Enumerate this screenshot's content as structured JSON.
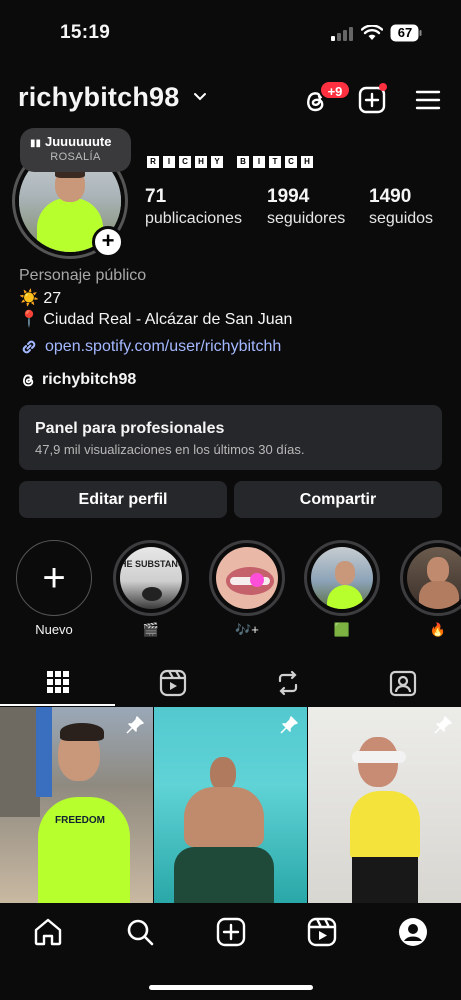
{
  "status_bar": {
    "time": "15:19",
    "battery": "67"
  },
  "header": {
    "username": "richybitch98",
    "notifications_badge": "+9",
    "icons": [
      "threads-icon",
      "add-post-icon",
      "menu-icon"
    ]
  },
  "note": {
    "song_title": "Juuuuuute",
    "artist": "ROSALÍA"
  },
  "profile": {
    "display_name_letters": [
      "R",
      "I",
      "C",
      "H",
      "Y",
      " ",
      "B",
      "I",
      "T",
      "C",
      "H"
    ],
    "stats": [
      {
        "value": "71",
        "label": "publicaciones"
      },
      {
        "value": "1994",
        "label": "seguidores"
      },
      {
        "value": "1490",
        "label": "seguidos"
      }
    ],
    "category": "Personaje público",
    "bio_line1": "☀️ 27",
    "bio_line2": "📍 Ciudad Real - Alcázar de San Juan",
    "link": "open.spotify.com/user/richybitchh",
    "threads_handle": "richybitch98"
  },
  "pro_panel": {
    "title": "Panel para profesionales",
    "subtitle": "47,9 mil visualizaciones en los últimos 30 días."
  },
  "buttons": {
    "edit": "Editar perfil",
    "share": "Compartir"
  },
  "stories": [
    {
      "label": "Nuevo"
    },
    {
      "label": "🎬"
    },
    {
      "label": "🎶+"
    },
    {
      "label": "🟩"
    },
    {
      "label": "🔥"
    }
  ],
  "story_thumb_text": "HE SUBSTANCE",
  "tabs": [
    "grid-icon",
    "reels-icon",
    "reposts-icon",
    "tagged-icon"
  ],
  "posts": [
    {
      "pinned": true,
      "shirt_text": "FREEDOM"
    },
    {
      "pinned": true
    },
    {
      "pinned": true
    }
  ],
  "colors": {
    "background": "#0b0b0c",
    "surface": "#26272a",
    "link": "#a4b8ff",
    "badge": "#ff3040",
    "accent_shirt": "#b8ff2e"
  }
}
